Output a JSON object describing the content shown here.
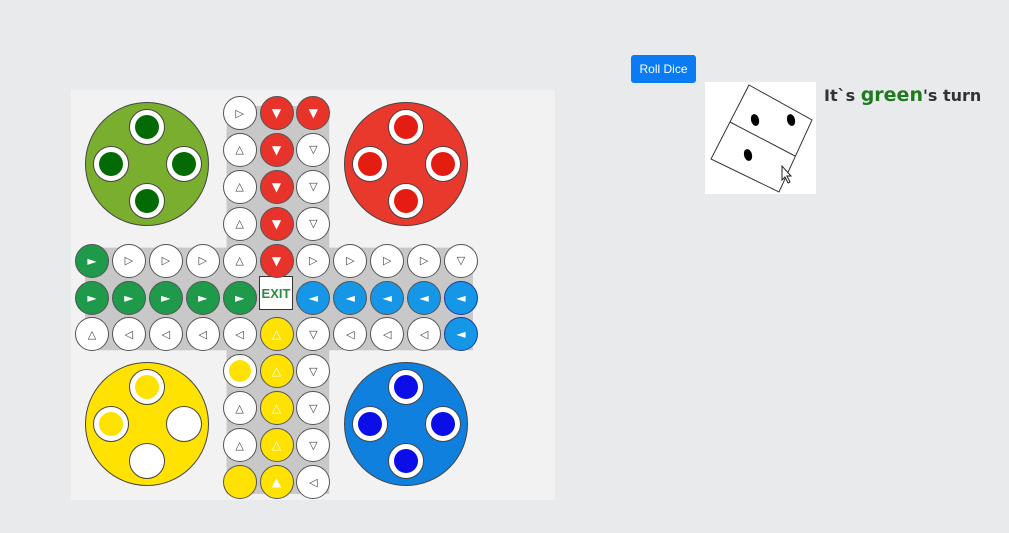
{
  "controls": {
    "roll_label": "Roll Dice"
  },
  "turn": {
    "prefix": "It`s ",
    "player": "green",
    "suffix": "'s turn"
  },
  "dice": {
    "value": 3
  },
  "board": {
    "exit_label": "EXIT",
    "colors": {
      "green": "#1e9a4a",
      "green_home": "#7aae2e",
      "green_pawn": "#046b04",
      "red": "#e8332a",
      "red_home": "#e8392c",
      "red_pawn": "#e41c12",
      "blue": "#1596e6",
      "blue_home": "#0f80de",
      "blue_pawn": "#0b0ee6",
      "yellow": "#ffe200",
      "yellow_home": "#ffe200",
      "yellow_pawn": "#ffe200",
      "path": "#c8c8c8",
      "white": "#ffffff"
    },
    "homes": [
      {
        "color": "green",
        "pawns": [
          true,
          true,
          true,
          true
        ]
      },
      {
        "color": "red",
        "pawns": [
          true,
          true,
          true,
          true
        ]
      },
      {
        "color": "yellow",
        "pawns": [
          true,
          true,
          false,
          false
        ]
      },
      {
        "color": "blue",
        "pawns": [
          true,
          true,
          true,
          true
        ]
      }
    ],
    "cells": [
      {
        "r": 0,
        "c": 4,
        "f": "white",
        "g": "▷"
      },
      {
        "r": 0,
        "c": 5,
        "f": "red",
        "g": "▼"
      },
      {
        "r": 0,
        "c": 6,
        "f": "red",
        "g": "▼"
      },
      {
        "r": 1,
        "c": 4,
        "f": "white",
        "g": "△"
      },
      {
        "r": 1,
        "c": 5,
        "f": "red",
        "g": "▼"
      },
      {
        "r": 1,
        "c": 6,
        "f": "white",
        "g": "▽"
      },
      {
        "r": 2,
        "c": 4,
        "f": "white",
        "g": "△"
      },
      {
        "r": 2,
        "c": 5,
        "f": "red",
        "g": "▼"
      },
      {
        "r": 2,
        "c": 6,
        "f": "white",
        "g": "▽"
      },
      {
        "r": 3,
        "c": 4,
        "f": "white",
        "g": "△"
      },
      {
        "r": 3,
        "c": 5,
        "f": "red",
        "g": "▼"
      },
      {
        "r": 3,
        "c": 6,
        "f": "white",
        "g": "▽"
      },
      {
        "r": 4,
        "c": 0,
        "f": "green",
        "g": "►"
      },
      {
        "r": 4,
        "c": 1,
        "f": "white",
        "g": "▷"
      },
      {
        "r": 4,
        "c": 2,
        "f": "white",
        "g": "▷"
      },
      {
        "r": 4,
        "c": 3,
        "f": "white",
        "g": "▷"
      },
      {
        "r": 4,
        "c": 4,
        "f": "white",
        "g": "△"
      },
      {
        "r": 4,
        "c": 5,
        "f": "red",
        "g": "▼"
      },
      {
        "r": 4,
        "c": 6,
        "f": "white",
        "g": "▷"
      },
      {
        "r": 4,
        "c": 7,
        "f": "white",
        "g": "▷"
      },
      {
        "r": 4,
        "c": 8,
        "f": "white",
        "g": "▷"
      },
      {
        "r": 4,
        "c": 9,
        "f": "white",
        "g": "▷"
      },
      {
        "r": 4,
        "c": 10,
        "f": "white",
        "g": "▽"
      },
      {
        "r": 5,
        "c": 0,
        "f": "green",
        "g": "►"
      },
      {
        "r": 5,
        "c": 1,
        "f": "green",
        "g": "►"
      },
      {
        "r": 5,
        "c": 2,
        "f": "green",
        "g": "►"
      },
      {
        "r": 5,
        "c": 3,
        "f": "green",
        "g": "►"
      },
      {
        "r": 5,
        "c": 4,
        "f": "green",
        "g": "►"
      },
      {
        "r": 5,
        "c": 6,
        "f": "blue",
        "g": "◄"
      },
      {
        "r": 5,
        "c": 7,
        "f": "blue",
        "g": "◄"
      },
      {
        "r": 5,
        "c": 8,
        "f": "blue",
        "g": "◄"
      },
      {
        "r": 5,
        "c": 9,
        "f": "blue",
        "g": "◄"
      },
      {
        "r": 5,
        "c": 10,
        "f": "blue",
        "g": "◄"
      },
      {
        "r": 6,
        "c": 0,
        "f": "white",
        "g": "△"
      },
      {
        "r": 6,
        "c": 1,
        "f": "white",
        "g": "◁"
      },
      {
        "r": 6,
        "c": 2,
        "f": "white",
        "g": "◁"
      },
      {
        "r": 6,
        "c": 3,
        "f": "white",
        "g": "◁"
      },
      {
        "r": 6,
        "c": 4,
        "f": "white",
        "g": "◁"
      },
      {
        "r": 6,
        "c": 5,
        "f": "yellow",
        "g": "△"
      },
      {
        "r": 6,
        "c": 6,
        "f": "white",
        "g": "▽"
      },
      {
        "r": 6,
        "c": 7,
        "f": "white",
        "g": "◁"
      },
      {
        "r": 6,
        "c": 8,
        "f": "white",
        "g": "◁"
      },
      {
        "r": 6,
        "c": 9,
        "f": "white",
        "g": "◁"
      },
      {
        "r": 6,
        "c": 10,
        "f": "blue",
        "g": "◄"
      },
      {
        "r": 7,
        "c": 4,
        "f": "white",
        "g": "",
        "p": "yellow"
      },
      {
        "r": 7,
        "c": 5,
        "f": "yellow",
        "g": "△"
      },
      {
        "r": 7,
        "c": 6,
        "f": "white",
        "g": "▽"
      },
      {
        "r": 8,
        "c": 4,
        "f": "white",
        "g": "△"
      },
      {
        "r": 8,
        "c": 5,
        "f": "yellow",
        "g": "△"
      },
      {
        "r": 8,
        "c": 6,
        "f": "white",
        "g": "▽"
      },
      {
        "r": 9,
        "c": 4,
        "f": "white",
        "g": "△"
      },
      {
        "r": 9,
        "c": 5,
        "f": "yellow",
        "g": "△"
      },
      {
        "r": 9,
        "c": 6,
        "f": "white",
        "g": "▽"
      },
      {
        "r": 10,
        "c": 4,
        "f": "yellow",
        "g": ""
      },
      {
        "r": 10,
        "c": 5,
        "f": "yellow",
        "g": "▲"
      },
      {
        "r": 10,
        "c": 6,
        "f": "white",
        "g": "◁"
      }
    ]
  }
}
